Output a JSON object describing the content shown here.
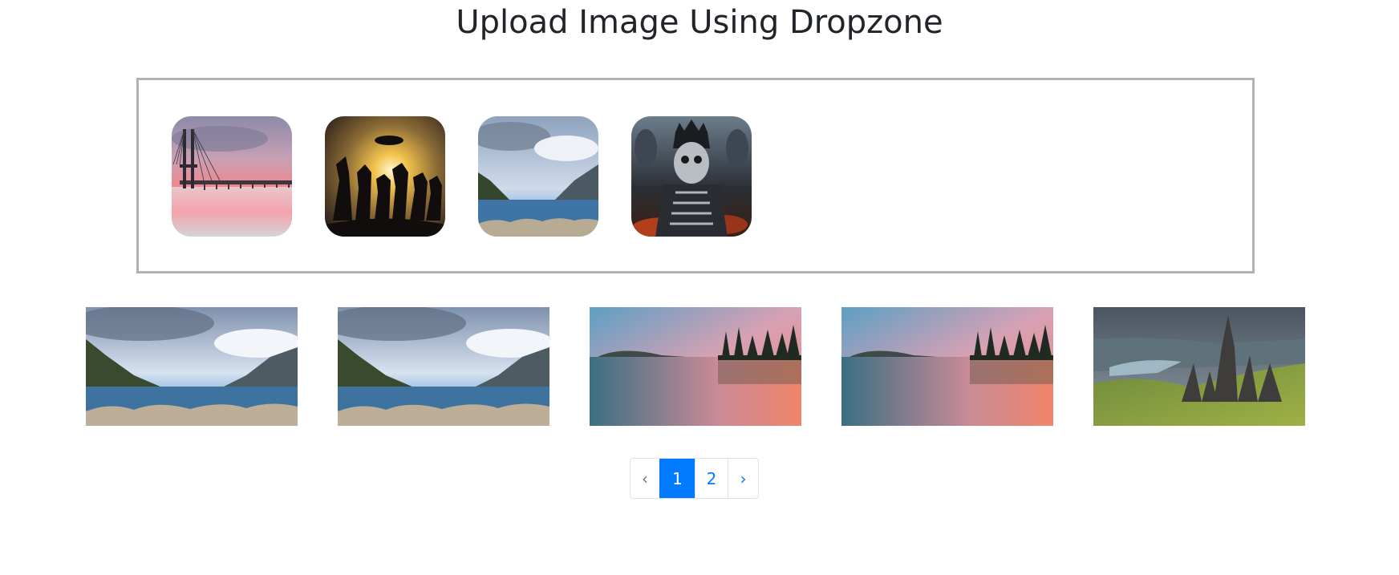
{
  "page": {
    "title": "Upload Image Using Dropzone"
  },
  "dropzone": {
    "previews": [
      {
        "name": "bridge-sunset-image"
      },
      {
        "name": "anime-silhouette-image"
      },
      {
        "name": "lake-mountains-image"
      },
      {
        "name": "armored-warrior-image"
      }
    ]
  },
  "gallery": {
    "images": [
      {
        "name": "lake-mountains-image"
      },
      {
        "name": "lake-mountains-image"
      },
      {
        "name": "sunset-lake-image"
      },
      {
        "name": "sunset-lake-image"
      },
      {
        "name": "rocky-highlands-image"
      }
    ]
  },
  "pagination": {
    "prev_label": "‹",
    "pages": [
      "1",
      "2"
    ],
    "active_page": "1",
    "next_label": "›"
  },
  "colors": {
    "accent": "#007bff",
    "dropzone_border": "#b3b3b3"
  }
}
